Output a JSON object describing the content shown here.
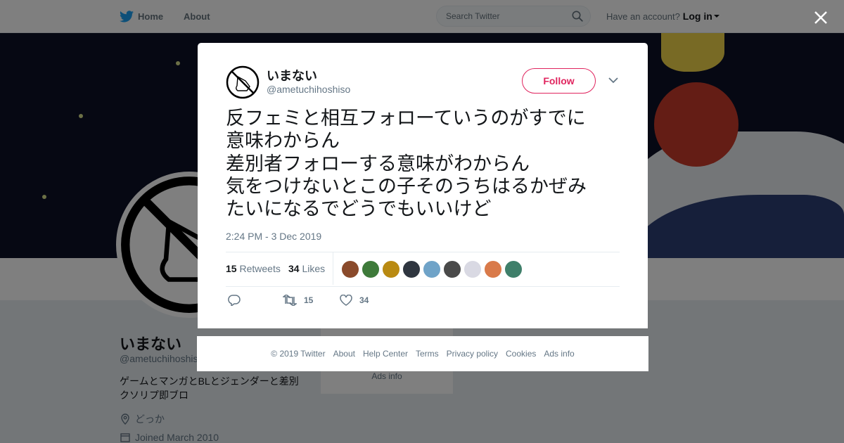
{
  "topbar": {
    "home_label": "Home",
    "about_label": "About",
    "search_placeholder": "Search Twitter",
    "account_prompt": "Have an account?",
    "login_label": "Log in"
  },
  "profile": {
    "name": "いまない",
    "handle": "@ametuchihoshiso",
    "bio": "ゲームとマンガとBLとジェンダーと差別\nクソリプ即ブロ",
    "location": "どっか",
    "joined": "Joined March 2010",
    "side_card_ads": "Ads info"
  },
  "tweet": {
    "author_name": "いまない",
    "author_handle": "@ametuchihoshiso",
    "follow_label": "Follow",
    "text": "反フェミと相互フォローていうのがすでに\n意味わからん\n差別者フォローする意味がわからん\n気をつけないとこの子そのうちはるかぜみ\nたいになるでどうでもいいけど",
    "timestamp": "2:24 PM - 3 Dec 2019",
    "retweets_count": "15",
    "retweets_label": "Retweets",
    "likes_count": "34",
    "likes_label": "Likes",
    "action_retweet_count": "15",
    "action_like_count": "34",
    "liker_avatars": [
      {
        "name": "liker-avatar-1",
        "color": "#8a4a2b"
      },
      {
        "name": "liker-avatar-2",
        "color": "#3e7a3a"
      },
      {
        "name": "liker-avatar-3",
        "color": "#b98a12"
      },
      {
        "name": "liker-avatar-4",
        "color": "#2f3640"
      },
      {
        "name": "liker-avatar-5",
        "color": "#6fa3c8"
      },
      {
        "name": "liker-avatar-6",
        "color": "#4a4a4a"
      },
      {
        "name": "liker-avatar-7",
        "color": "#d9d9e3"
      },
      {
        "name": "liker-avatar-8",
        "color": "#d97a4a"
      },
      {
        "name": "liker-avatar-9",
        "color": "#3f7f6a"
      }
    ]
  },
  "footer": {
    "links": [
      "© 2019 Twitter",
      "About",
      "Help Center",
      "Terms",
      "Privacy policy",
      "Cookies",
      "Ads info"
    ]
  },
  "colors": {
    "accent_follow": "#e0245e",
    "twitter_blue": "#1da1f2",
    "text_secondary": "#657786"
  }
}
